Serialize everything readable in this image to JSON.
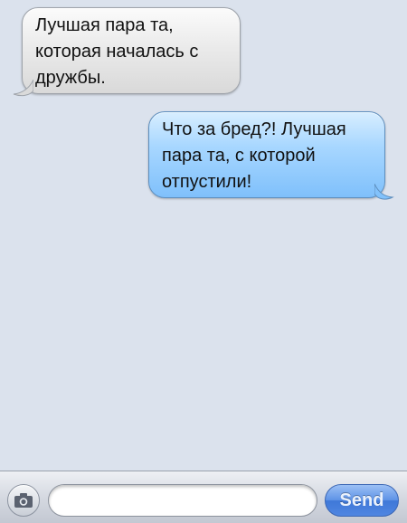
{
  "messages": [
    {
      "direction": "incoming",
      "text": "Лучшая пара та, которая началась с дружбы."
    },
    {
      "direction": "outgoing",
      "text": "Что за бред?! Лучшая пара та, с которой отпустили!"
    }
  ],
  "composer": {
    "placeholder": "",
    "value": "",
    "send_label": "Send",
    "camera_icon": "camera-icon"
  },
  "colors": {
    "background": "#dbe2ed",
    "incoming_bubble": "#e4e4e4",
    "outgoing_bubble": "#a8d7ff",
    "send_button": "#4f86e1"
  }
}
